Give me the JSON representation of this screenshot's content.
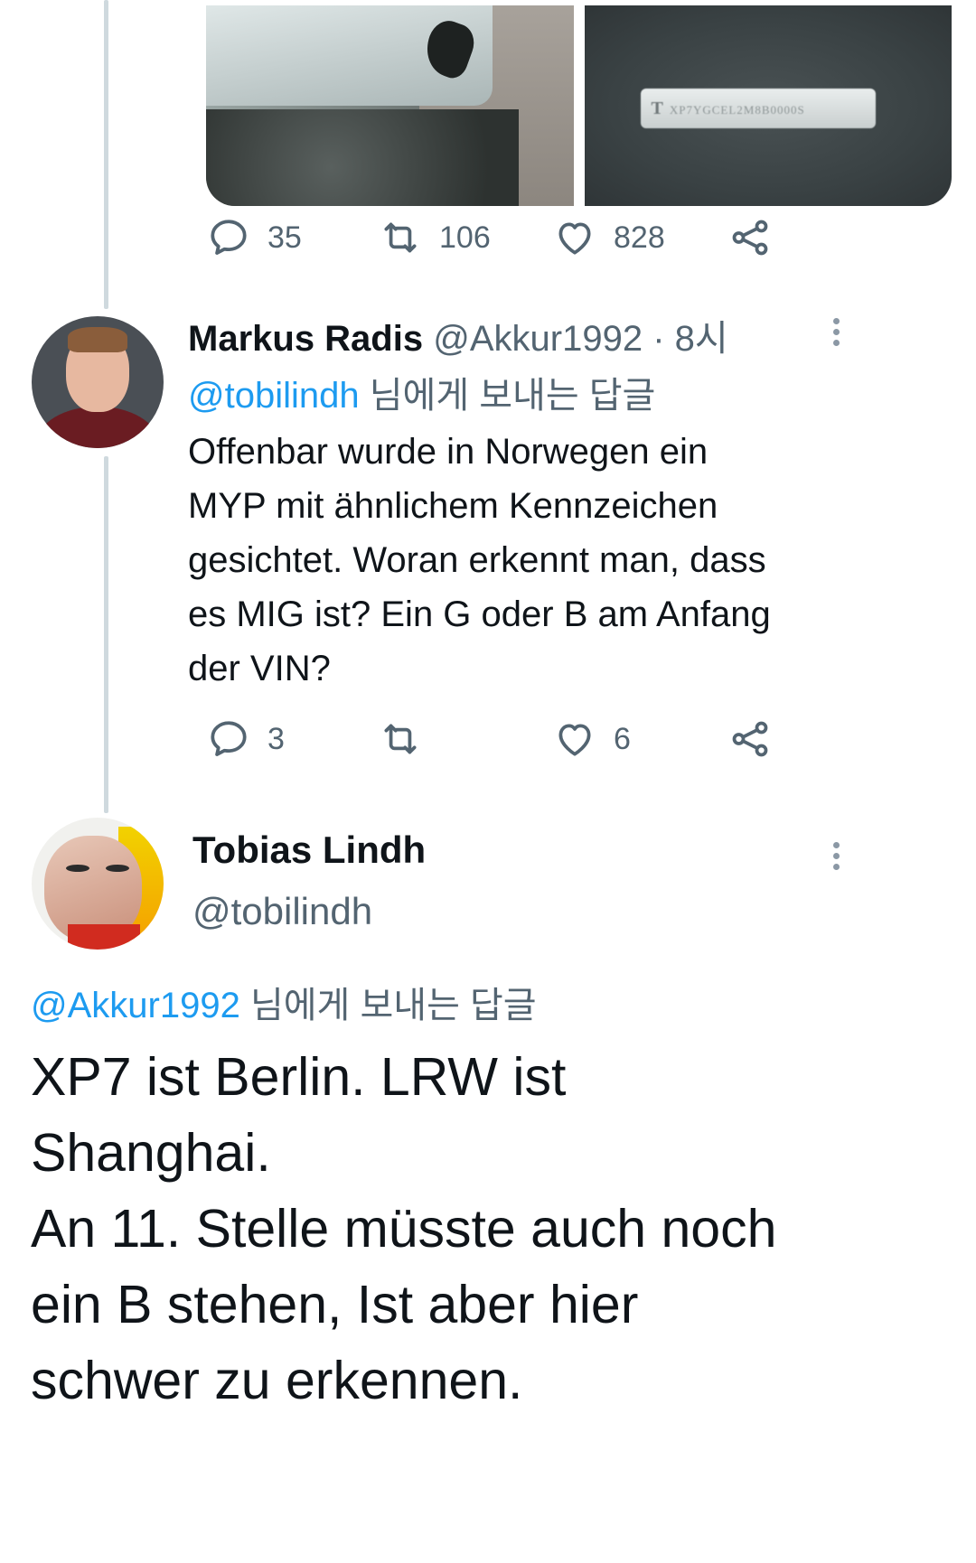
{
  "colors": {
    "link": "#1d9bf0",
    "secondary": "#536471",
    "thread_line": "#cfd9de"
  },
  "tweet_original": {
    "media": [
      {
        "alt_icon": "car-photo"
      },
      {
        "alt_icon": "vin-plate-photo",
        "plate_text": "XP7YGCEL2M8B0000S"
      }
    ],
    "actions": {
      "replies": "35",
      "retweets": "106",
      "likes": "828"
    }
  },
  "tweet_reply": {
    "name": "Markus Radis",
    "handle": "@Akkur1992",
    "separator": "·",
    "time": "8시",
    "replying_to_handle": "@tobilindh",
    "replying_to_suffix": " 님에게 보내는 답글",
    "text": "Offenbar wurde in Norwegen ein\nMYP mit ähnlichem Kennzeichen\ngesichtet. Woran erkennt man, dass\nes MIG ist? Ein G oder B am Anfang\nder VIN?",
    "actions": {
      "replies": "3",
      "retweets": "",
      "likes": "6"
    }
  },
  "tweet_main": {
    "name": "Tobias Lindh",
    "handle": "@tobilindh",
    "replying_to_handle": "@Akkur1992",
    "replying_to_suffix": " 님에게 보내는 답글",
    "text": "XP7 ist Berlin. LRW ist\nShanghai.\nAn 11. Stelle müsste auch noch\nein B stehen, Ist aber hier\nschwer zu erkennen."
  }
}
